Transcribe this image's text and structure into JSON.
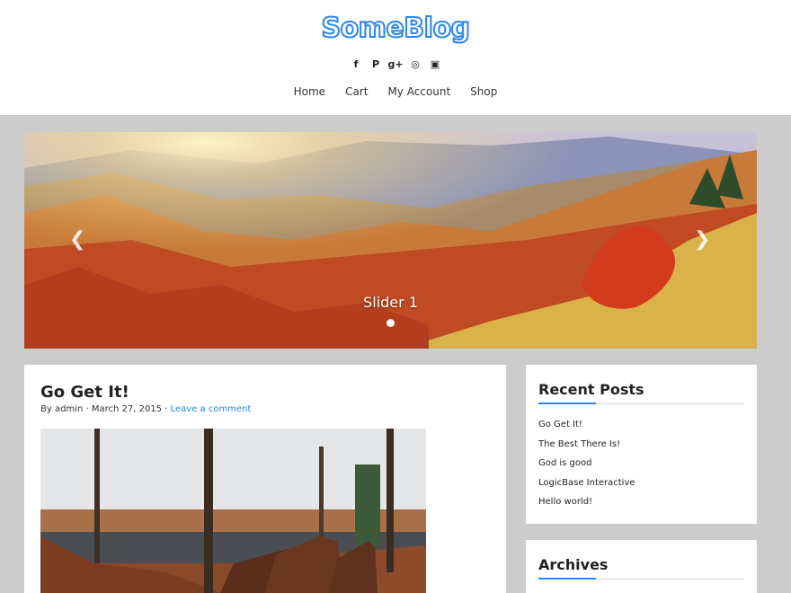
{
  "site": {
    "logo_text": "SomeBlog",
    "brand_color": "#2a86e8"
  },
  "social": [
    {
      "icon": "facebook-icon",
      "glyph": "f"
    },
    {
      "icon": "pinterest-icon",
      "glyph": "P"
    },
    {
      "icon": "google-plus-icon",
      "glyph": "g+"
    },
    {
      "icon": "dribbble-icon",
      "glyph": "◎"
    },
    {
      "icon": "instagram-icon",
      "glyph": "▣"
    }
  ],
  "nav": {
    "items": [
      "Home",
      "Cart",
      "My Account",
      "Shop"
    ]
  },
  "slider": {
    "caption": "Slider 1",
    "prev_glyph": "❮",
    "next_glyph": "❯"
  },
  "post": {
    "title": "Go Get It!",
    "author_prefix": "By admin",
    "separator": " · ",
    "date": "March 27, 2015",
    "comment_link": "Leave a comment"
  },
  "sidebar": {
    "recent": {
      "title": "Recent Posts",
      "items": [
        "Go Get It!",
        "The Best There Is!",
        "God is good",
        "LogicBase Interactive",
        "Hello world!"
      ]
    },
    "archives": {
      "title": "Archives"
    }
  }
}
